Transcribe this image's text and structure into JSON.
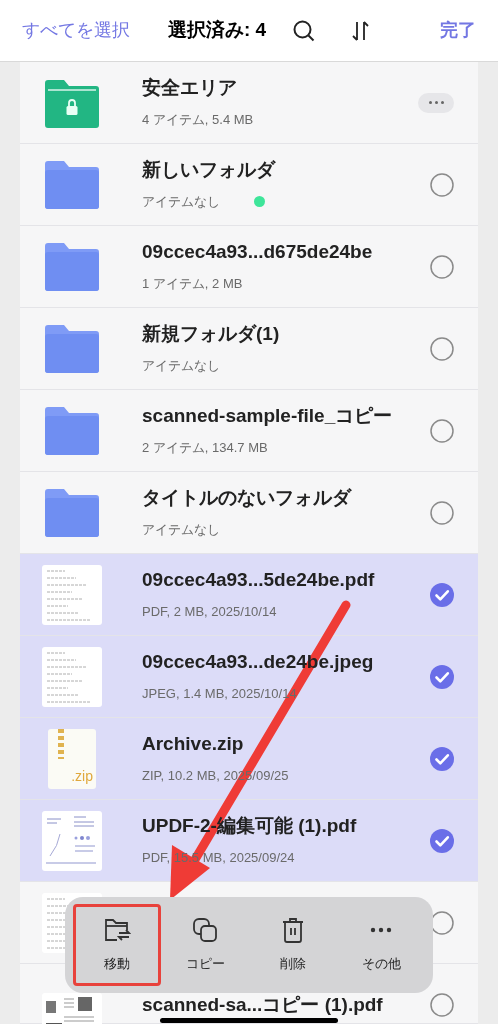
{
  "header": {
    "select_all": "すべてを選択",
    "title": "選択済み: 4",
    "done": "完了"
  },
  "rows": [
    {
      "kind": "locked_folder",
      "name": "安全エリア",
      "meta": "4 アイテム, 5.4 MB",
      "selected": false,
      "new_dot": false
    },
    {
      "kind": "folder",
      "name": "新しいフォルダ",
      "meta": "アイテムなし",
      "selected": false,
      "new_dot": true
    },
    {
      "kind": "folder",
      "name": "09ccec4a93...d675de24be",
      "meta": "1 アイテム, 2 MB",
      "selected": false,
      "new_dot": false
    },
    {
      "kind": "folder",
      "name": "新規フォルダ(1)",
      "meta": "アイテムなし",
      "selected": false,
      "new_dot": false
    },
    {
      "kind": "folder",
      "name": "scanned-sample-file_コピー",
      "meta": "2 アイテム, 134.7 MB",
      "selected": false,
      "new_dot": false
    },
    {
      "kind": "folder",
      "name": "タイトルのないフォルダ",
      "meta": "アイテムなし",
      "selected": false,
      "new_dot": false
    },
    {
      "kind": "document",
      "name": "09ccec4a93...5de24be.pdf",
      "meta": "PDF, 2 MB, 2025/10/14",
      "selected": true,
      "new_dot": false
    },
    {
      "kind": "document",
      "name": "09ccec4a93...de24be.jpeg",
      "meta": "JPEG, 1.4 MB, 2025/10/14",
      "selected": true,
      "new_dot": false
    },
    {
      "kind": "zip",
      "badge": ".zip",
      "name": "Archive.zip",
      "meta": "ZIP, 10.2 MB, 2025/09/25",
      "selected": true,
      "new_dot": false
    },
    {
      "kind": "chart_document",
      "name": "UPDF-2-編集可能 (1).pdf",
      "meta": "PDF, 15.5 MB, 2025/09/24",
      "selected": true,
      "new_dot": false
    },
    {
      "kind": "document",
      "selected": false
    },
    {
      "kind": "photo_document",
      "name": "scanned-sa...コピー (1).pdf",
      "selected": false
    }
  ],
  "action_bar": [
    {
      "kind": "move",
      "label": "移動",
      "highlighted": true
    },
    {
      "kind": "copy",
      "label": "コピー",
      "highlighted": false
    },
    {
      "kind": "delete",
      "label": "削除",
      "highlighted": false
    },
    {
      "kind": "more",
      "label": "その他",
      "highlighted": false
    }
  ],
  "annotation": {
    "kind": "arrow"
  }
}
